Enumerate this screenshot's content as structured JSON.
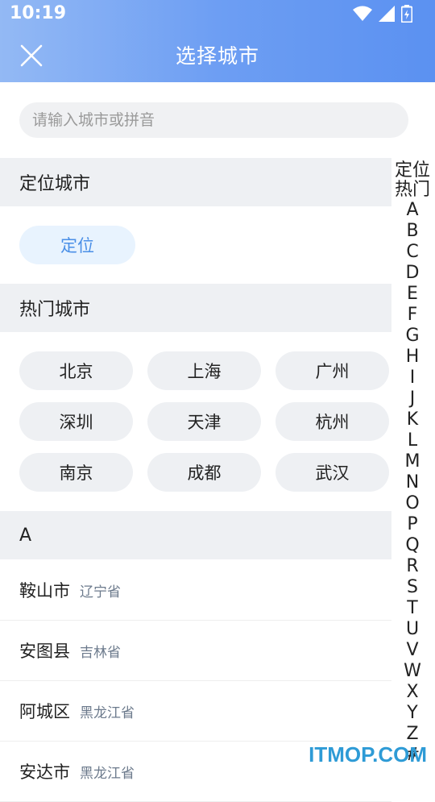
{
  "status": {
    "time": "10:19"
  },
  "header": {
    "title": "选择城市"
  },
  "search": {
    "placeholder": "请输入城市或拼音"
  },
  "location": {
    "header": "定位城市",
    "button": "定位"
  },
  "hot": {
    "header": "热门城市",
    "cities": [
      "北京",
      "上海",
      "广州",
      "深圳",
      "天津",
      "杭州",
      "南京",
      "成都",
      "武汉"
    ]
  },
  "list": {
    "section": "A",
    "cities": [
      {
        "name": "鞍山市",
        "province": "辽宁省"
      },
      {
        "name": "安图县",
        "province": "吉林省"
      },
      {
        "name": "阿城区",
        "province": "黑龙江省"
      },
      {
        "name": "安达市",
        "province": "黑龙江省"
      }
    ]
  },
  "index": [
    "定位",
    "热门",
    "A",
    "B",
    "C",
    "D",
    "E",
    "F",
    "G",
    "H",
    "I",
    "J",
    "K",
    "L",
    "M",
    "N",
    "O",
    "P",
    "Q",
    "R",
    "S",
    "T",
    "U",
    "V",
    "W",
    "X",
    "Y",
    "Z",
    "#"
  ],
  "watermark": "ITMOP.COM"
}
